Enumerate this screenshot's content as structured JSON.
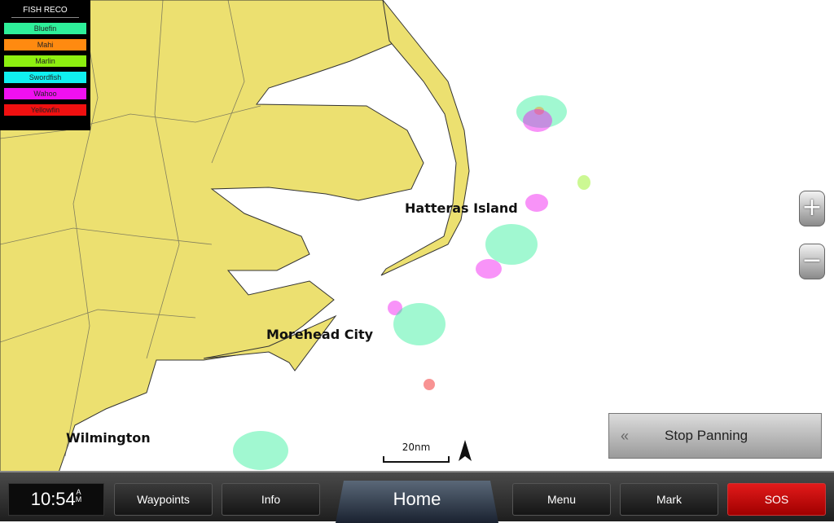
{
  "legend": {
    "title": "FISH RECO",
    "items": [
      {
        "label": "Bluefin",
        "color": "#2ef09a"
      },
      {
        "label": "Mahi",
        "color": "#ff8a10"
      },
      {
        "label": "Marlin",
        "color": "#8ef010"
      },
      {
        "label": "Swordfish",
        "color": "#10f0f0"
      },
      {
        "label": "Wahoo",
        "color": "#f010f0"
      },
      {
        "label": "Yellowfin",
        "color": "#f01010"
      }
    ]
  },
  "places": {
    "hatteras": "Hatteras Island",
    "morehead": "Morehead City",
    "wilmington": "Wilmington"
  },
  "map": {
    "land_color": "#ece070",
    "water_color": "#ffffff",
    "scale": "20nm",
    "north": "N"
  },
  "zoom": {
    "in": "+",
    "out": "−"
  },
  "stop_panning": {
    "icon": "«",
    "label": "Stop Panning"
  },
  "bottom_bar": {
    "time": "10:54",
    "ampm_a": "A",
    "ampm_m": "M",
    "waypoints": "Waypoints",
    "info": "Info",
    "home": "Home",
    "menu": "Menu",
    "mark": "Mark",
    "sos": "SOS"
  }
}
